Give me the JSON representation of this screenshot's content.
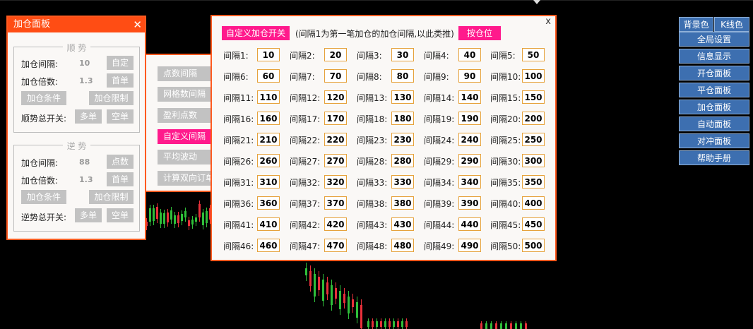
{
  "left_panel": {
    "title": "加仓面板",
    "close": "✕",
    "trend": {
      "legend": "顺 势",
      "interval_label": "加仓间隔:",
      "interval_value": "10",
      "interval_btn": "自定",
      "multiple_label": "加仓倍数:",
      "multiple_value": "1.3",
      "multiple_btn": "首单",
      "condition_btn": "加仓条件",
      "limit_btn": "加仓限制",
      "switch_label": "顺势总开关:",
      "long_btn": "多单",
      "short_btn": "空单"
    },
    "counter": {
      "legend": "逆 势",
      "interval_label": "加仓间隔:",
      "interval_value": "88",
      "interval_btn": "点数",
      "multiple_label": "加仓倍数:",
      "multiple_value": "1.3",
      "multiple_btn": "首单",
      "condition_btn": "加仓条件",
      "limit_btn": "加仓限制",
      "switch_label": "逆势总开关:",
      "long_btn": "多单",
      "short_btn": "空单"
    }
  },
  "mid_menu": {
    "items": [
      "点数间隔",
      "网格数间隔",
      "盈利点数",
      "自定义间隔",
      "平均波动",
      "计算双向订单"
    ],
    "active_index": 3
  },
  "main_panel": {
    "close": "x",
    "toggle_btn": "自定义加仓开关",
    "note": "(间隔1为第一笔加仓的加仓间隔,以此类推)",
    "position_btn": "按仓位",
    "intervals": [
      {
        "label": "间隔1:",
        "value": "10"
      },
      {
        "label": "间隔2:",
        "value": "20"
      },
      {
        "label": "间隔3:",
        "value": "30"
      },
      {
        "label": "间隔4:",
        "value": "40"
      },
      {
        "label": "间隔5:",
        "value": "50"
      },
      {
        "label": "间隔6:",
        "value": "60"
      },
      {
        "label": "间隔7:",
        "value": "70"
      },
      {
        "label": "间隔8:",
        "value": "80"
      },
      {
        "label": "间隔9:",
        "value": "90"
      },
      {
        "label": "间隔10:",
        "value": "100"
      },
      {
        "label": "间隔11:",
        "value": "110"
      },
      {
        "label": "间隔12:",
        "value": "120"
      },
      {
        "label": "间隔13:",
        "value": "130"
      },
      {
        "label": "间隔14:",
        "value": "140"
      },
      {
        "label": "间隔15:",
        "value": "150"
      },
      {
        "label": "间隔16:",
        "value": "160"
      },
      {
        "label": "间隔17:",
        "value": "170"
      },
      {
        "label": "间隔18:",
        "value": "180"
      },
      {
        "label": "间隔19:",
        "value": "190"
      },
      {
        "label": "间隔20:",
        "value": "200"
      },
      {
        "label": "间隔21:",
        "value": "210"
      },
      {
        "label": "间隔22:",
        "value": "220"
      },
      {
        "label": "间隔23:",
        "value": "230"
      },
      {
        "label": "间隔24:",
        "value": "240"
      },
      {
        "label": "间隔25:",
        "value": "250"
      },
      {
        "label": "间隔26:",
        "value": "260"
      },
      {
        "label": "间隔27:",
        "value": "270"
      },
      {
        "label": "间隔28:",
        "value": "280"
      },
      {
        "label": "间隔29:",
        "value": "290"
      },
      {
        "label": "间隔30:",
        "value": "300"
      },
      {
        "label": "间隔31:",
        "value": "310"
      },
      {
        "label": "间隔32:",
        "value": "320"
      },
      {
        "label": "间隔33:",
        "value": "330"
      },
      {
        "label": "间隔34:",
        "value": "340"
      },
      {
        "label": "间隔35:",
        "value": "350"
      },
      {
        "label": "间隔36:",
        "value": "360"
      },
      {
        "label": "间隔37:",
        "value": "370"
      },
      {
        "label": "间隔38:",
        "value": "380"
      },
      {
        "label": "间隔39:",
        "value": "390"
      },
      {
        "label": "间隔40:",
        "value": "400"
      },
      {
        "label": "间隔41:",
        "value": "410"
      },
      {
        "label": "间隔42:",
        "value": "420"
      },
      {
        "label": "间隔43:",
        "value": "430"
      },
      {
        "label": "间隔44:",
        "value": "440"
      },
      {
        "label": "间隔45:",
        "value": "450"
      },
      {
        "label": "间隔46:",
        "value": "460"
      },
      {
        "label": "间隔47:",
        "value": "470"
      },
      {
        "label": "间隔48:",
        "value": "480"
      },
      {
        "label": "间隔49:",
        "value": "490"
      },
      {
        "label": "间隔50:",
        "value": "500"
      }
    ]
  },
  "right_menu": {
    "top_left": "背景色",
    "top_right": "K线色",
    "items": [
      "全局设置",
      "信息显示",
      "开仓面板",
      "平仓面板",
      "加仓面板",
      "自动面板",
      "对冲面板",
      "帮助手册"
    ]
  },
  "colors": {
    "panel_border": "#ff5a1f",
    "title_bar": "#ff4d14",
    "pink_accent": "#ff1a8c",
    "right_menu_blue": "#3d6fb0",
    "candle_green": "#2fbf3a",
    "candle_red": "#e8303a"
  }
}
